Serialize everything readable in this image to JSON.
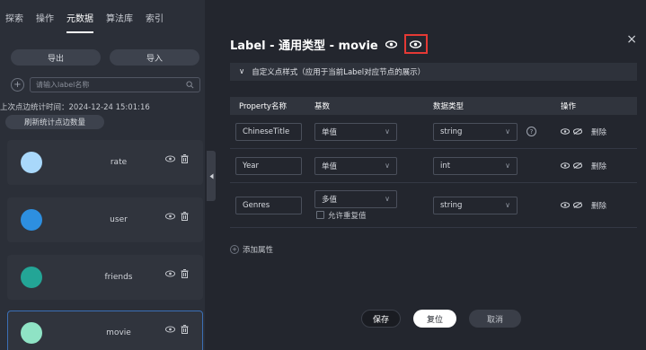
{
  "tabs": [
    "探索",
    "操作",
    "元数据",
    "算法库",
    "索引"
  ],
  "active_tab_index": 2,
  "left": {
    "export_label": "导出",
    "import_label": "导入",
    "add_symbol": "+",
    "search_placeholder": "请输入label名称",
    "stat_time": "上次点边统计时间：2024-12-24 15:01:16",
    "refresh_label": "刷新统计点边数量",
    "labels": [
      {
        "name": "rate",
        "color": "#a9d8fb"
      },
      {
        "name": "user",
        "color": "#2d8fe0"
      },
      {
        "name": "friends",
        "color": "#23a596"
      },
      {
        "name": "movie",
        "color": "#8fe3c5"
      }
    ],
    "active_label_index": 3
  },
  "right": {
    "title": "Label - 通用类型 - movie",
    "close_symbol": "×",
    "section_toggle": "∨",
    "section_title": "自定义点样式（应用于当前Label对应节点的展示）",
    "columns": [
      "Property名称",
      "基数",
      "数据类型",
      "操作"
    ],
    "rows": [
      {
        "name": "ChineseTitle",
        "cardinality": "单值",
        "type": "string",
        "help": "?",
        "delete": "删除"
      },
      {
        "name": "Year",
        "cardinality": "单值",
        "type": "int",
        "delete": "删除"
      },
      {
        "name": "Genres",
        "cardinality": "多值",
        "allow_dup": "允许重复值",
        "type": "string",
        "delete": "删除"
      }
    ],
    "add_property": "添加属性",
    "add_symbol": "+",
    "save": "保存",
    "reset": "复位",
    "cancel": "取消"
  }
}
